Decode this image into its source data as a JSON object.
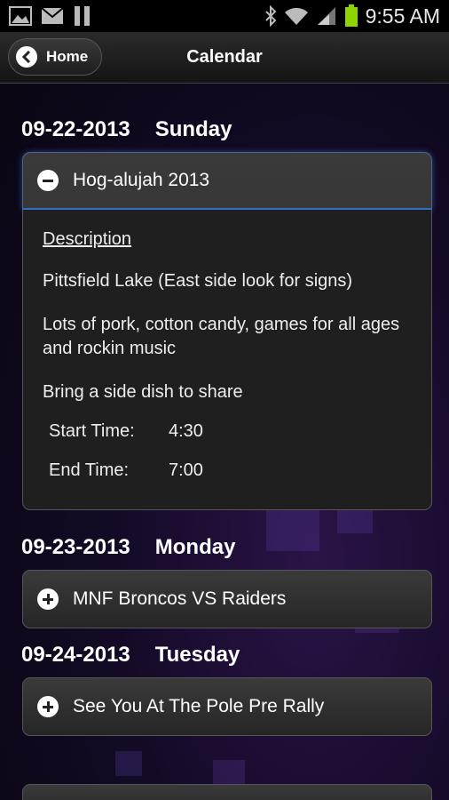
{
  "status_bar": {
    "time": "9:55 AM"
  },
  "header": {
    "back_label": "Home",
    "title": "Calendar"
  },
  "days": [
    {
      "date": "09-22-2013",
      "weekday": "Sunday"
    },
    {
      "date": "09-23-2013",
      "weekday": "Monday"
    },
    {
      "date": "09-24-2013",
      "weekday": "Tuesday"
    }
  ],
  "events": [
    {
      "title": "Hog-alujah 2013",
      "expanded": true,
      "description_heading": "Description",
      "paragraphs": [
        "Pittsfield Lake  (East side look for signs)",
        "Lots of pork, cotton candy, games for all ages and rockin music",
        "Bring a side dish to share"
      ],
      "start_label": "Start Time:",
      "start_value": "4:30",
      "end_label": "End Time:",
      "end_value": "7:00"
    },
    {
      "title": "MNF Broncos VS Raiders",
      "expanded": false
    },
    {
      "title": "See You At The Pole Pre Rally",
      "expanded": false
    }
  ],
  "colors": {
    "accent": "#2f6fc8",
    "background": "#140a26"
  }
}
